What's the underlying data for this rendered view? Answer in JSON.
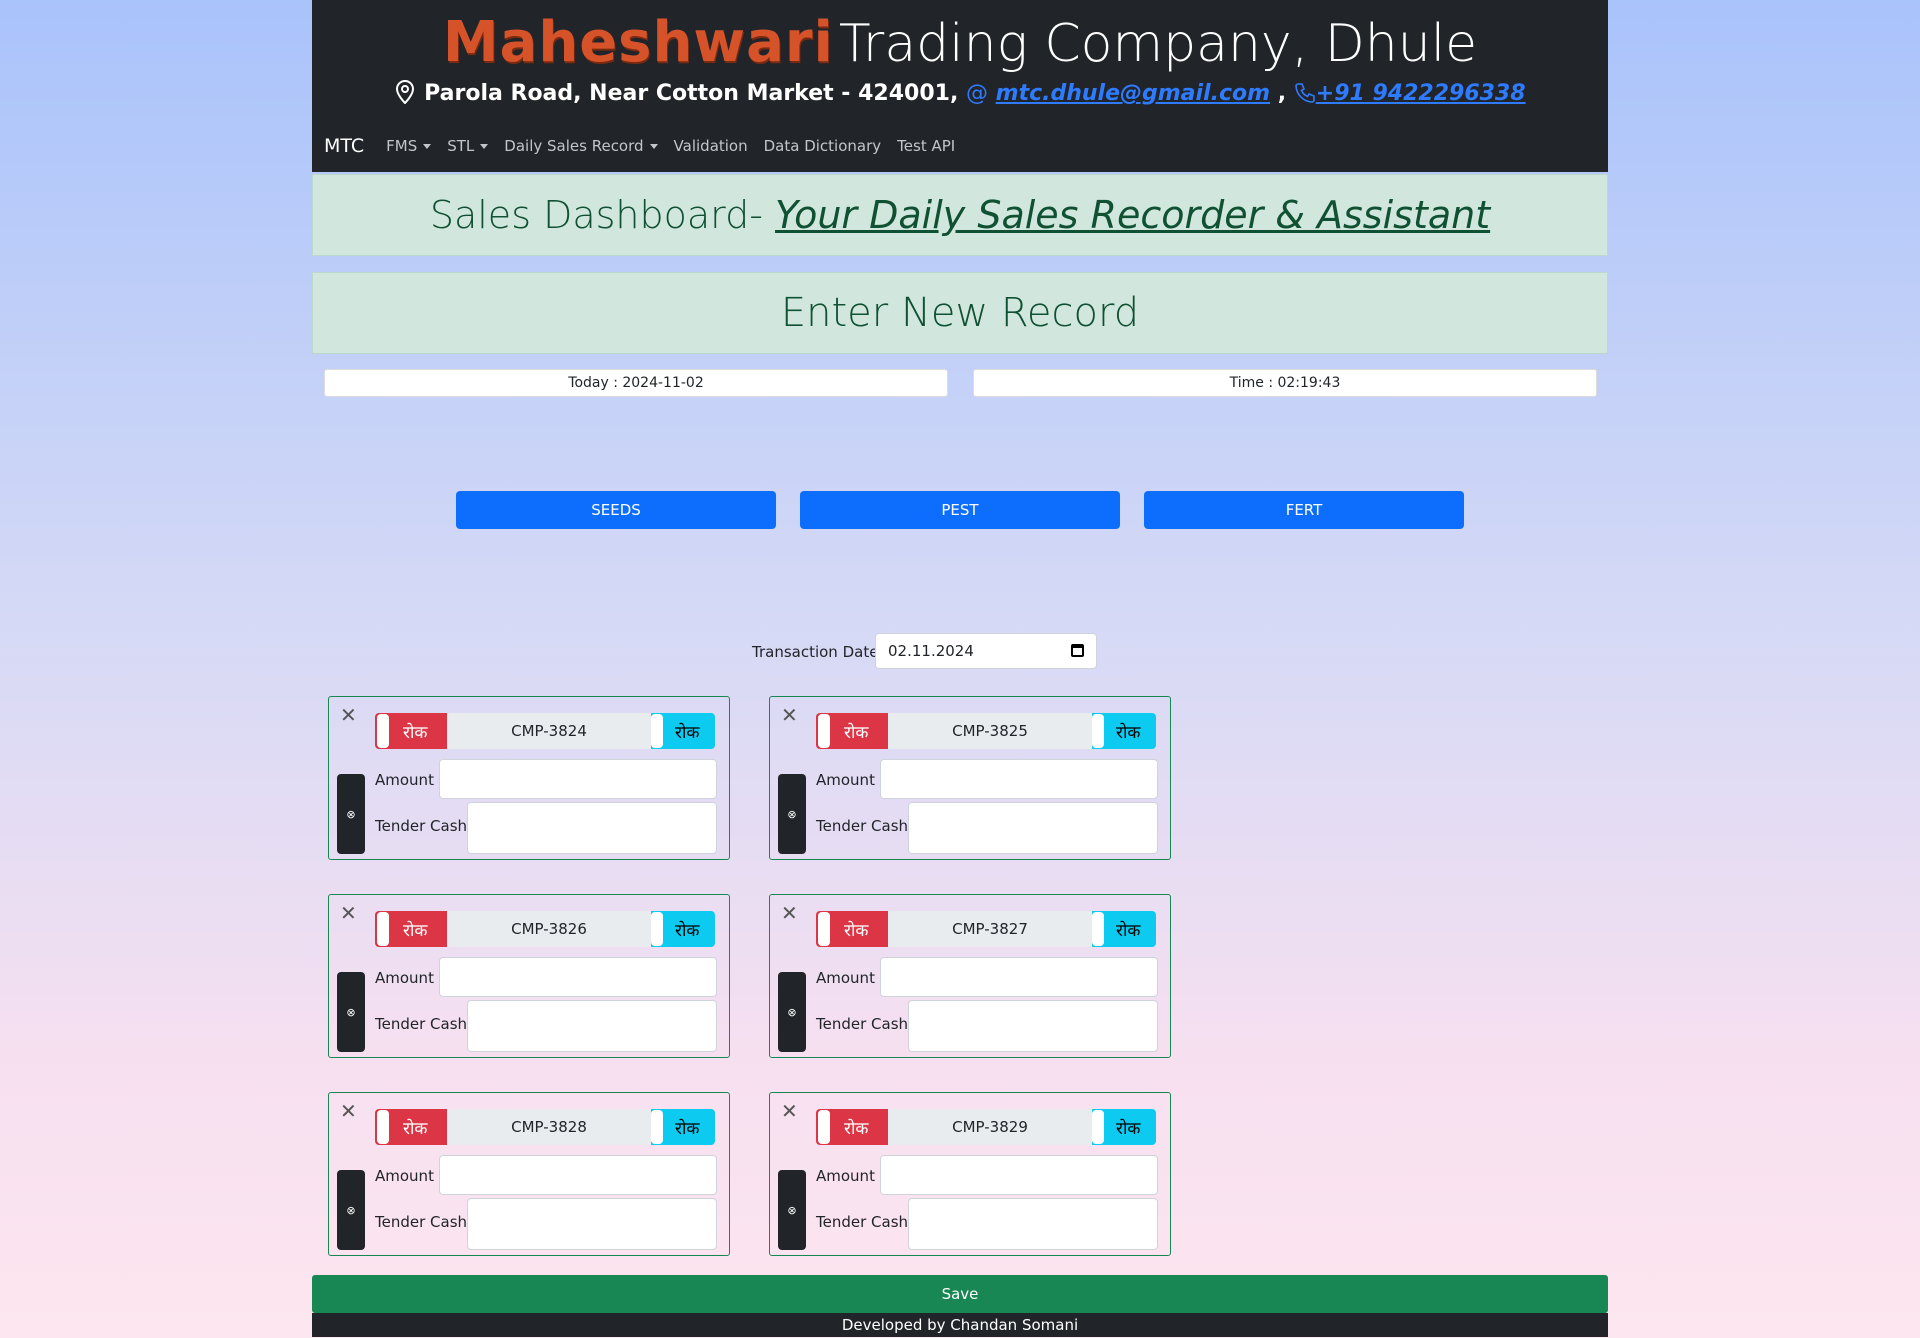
{
  "header": {
    "brand_highlight": "Maheshwari",
    "brand_rest": "Trading Company, Dhule",
    "address": "Parola Road, Near Cotton Market - 424001,",
    "email_prefix": "@",
    "email": "mtc.dhule@gmail.com",
    "separator": ",",
    "phone": "+91 9422296338",
    "icons": [
      "location-pin-icon",
      "phone-icon"
    ]
  },
  "nav": {
    "brand": "MTC",
    "items": [
      {
        "label": "FMS",
        "dropdown": true
      },
      {
        "label": "STL",
        "dropdown": true
      },
      {
        "label": "Daily Sales Record",
        "dropdown": true
      },
      {
        "label": "Validation",
        "dropdown": false
      },
      {
        "label": "Data Dictionary",
        "dropdown": false
      },
      {
        "label": "Test API",
        "dropdown": false
      }
    ]
  },
  "dashboard": {
    "title": "Sales Dashboard-",
    "subtitle": "Your Daily Sales Recorder & Assistant"
  },
  "form": {
    "heading": "Enter New Record",
    "today": "Today : 2024-11-02",
    "time": "Time : 02:19:43",
    "categories": [
      "SEEDS",
      "PEST",
      "FERT"
    ],
    "transaction_label": "Transaction Date",
    "transaction_date": "02.11.2024"
  },
  "cards": [
    {
      "code": "CMP-3824",
      "left_toggle": "रोक",
      "right_toggle": "रोक",
      "side": "⊗",
      "amount_label": "Amount",
      "tender_label": "Tender Cash"
    },
    {
      "code": "CMP-3825",
      "left_toggle": "रोक",
      "right_toggle": "रोक",
      "side": "⊗",
      "amount_label": "Amount",
      "tender_label": "Tender Cash"
    },
    {
      "code": "CMP-3826",
      "left_toggle": "रोक",
      "right_toggle": "रोक",
      "side": "⊗",
      "amount_label": "Amount",
      "tender_label": "Tender Cash"
    },
    {
      "code": "CMP-3827",
      "left_toggle": "रोक",
      "right_toggle": "रोक",
      "side": "⊗",
      "amount_label": "Amount",
      "tender_label": "Tender Cash"
    },
    {
      "code": "CMP-3828",
      "left_toggle": "रोक",
      "right_toggle": "रोक",
      "side": "⊗",
      "amount_label": "Amount",
      "tender_label": "Tender Cash"
    },
    {
      "code": "CMP-3829",
      "left_toggle": "रोक",
      "right_toggle": "रोक",
      "side": "⊗",
      "amount_label": "Amount",
      "tender_label": "Tender Cash"
    }
  ],
  "actions": {
    "save": "Save"
  },
  "footer": {
    "credit": "Developed by Chandan Somani"
  },
  "colors": {
    "header_bg": "#212529",
    "brand_orange": "#d6532a",
    "link_blue": "#2f7bff",
    "primary": "#0d6efd",
    "success": "#198754",
    "danger": "#dc3545",
    "info": "#0dcaf0",
    "banner_bg": "#d1e7dd"
  }
}
